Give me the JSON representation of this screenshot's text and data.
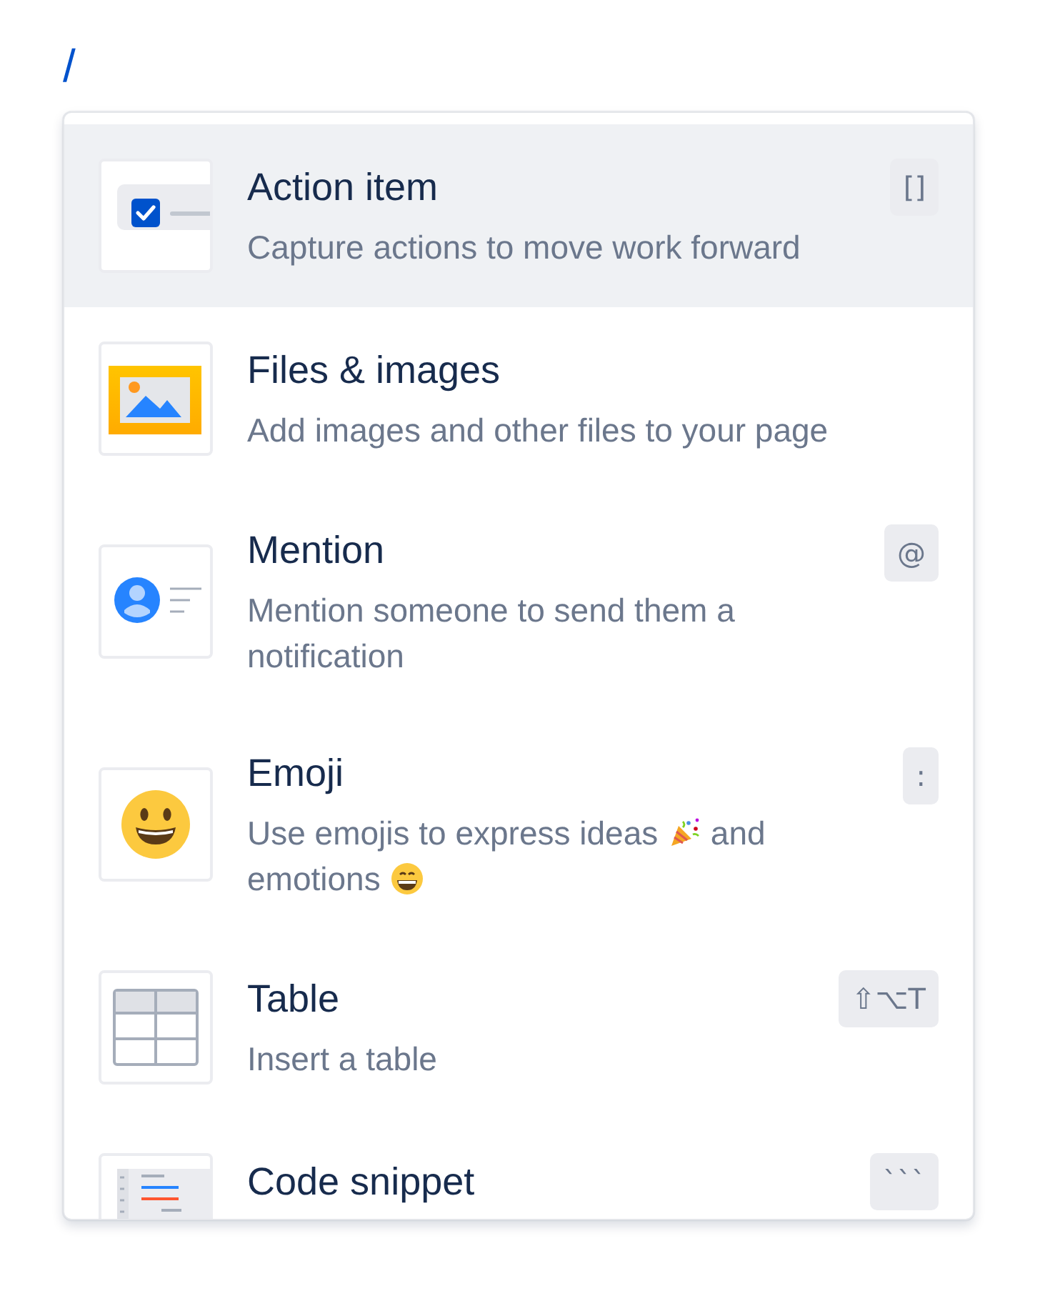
{
  "query": "/",
  "items": [
    {
      "kind": "action",
      "title": "Action item",
      "description": [
        {
          "kind": "text",
          "text": "Capture actions to move work forward"
        }
      ],
      "shortcut": "[]",
      "selected": true
    },
    {
      "kind": "files",
      "title": "Files & images",
      "description": [
        {
          "kind": "text",
          "text": "Add images and other files to your page"
        }
      ],
      "selected": false
    },
    {
      "kind": "mention",
      "title": "Mention",
      "description": [
        {
          "kind": "text",
          "text": "Mention someone to send them a notification"
        }
      ],
      "shortcut": "@",
      "selected": false
    },
    {
      "kind": "emoji",
      "title": "Emoji",
      "description": [
        {
          "kind": "text",
          "text": "Use emojis to express ideas "
        },
        {
          "kind": "party"
        },
        {
          "kind": "text",
          "text": " and emotions "
        },
        {
          "kind": "grin"
        }
      ],
      "shortcut": ":",
      "selected": false
    },
    {
      "kind": "table",
      "title": "Table",
      "description": [
        {
          "kind": "text",
          "text": "Insert a table"
        }
      ],
      "shortcut": "⇧⌥T",
      "selected": false
    },
    {
      "kind": "code",
      "title": "Code snippet",
      "shortcut": "```",
      "selected": false
    }
  ]
}
